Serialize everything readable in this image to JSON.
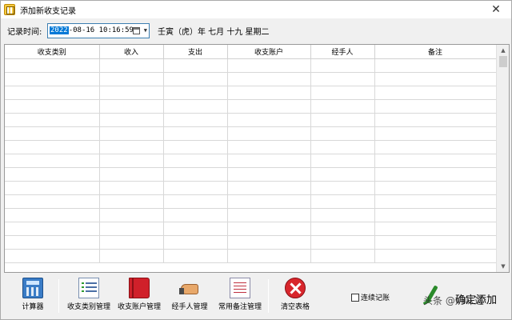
{
  "window": {
    "title": "添加新收支记录",
    "close_label": "✕"
  },
  "record_time": {
    "label": "记录时间:",
    "date_selected": "2022",
    "date_rest": "-08-16 10:16:59",
    "lunar": "壬寅（虎）年 七月 十九 星期二"
  },
  "grid": {
    "columns": [
      "收支类别",
      "收入",
      "支出",
      "收支账户",
      "经手人",
      "备注"
    ],
    "row_count": 15
  },
  "toolbar": {
    "calculator": "计算器",
    "category_mgmt": "收支类别管理",
    "account_mgmt": "收支账户管理",
    "handler_mgmt": "经手人管理",
    "note_mgmt": "常用备注管理",
    "clear_table": "清空表格",
    "continuous_label": "连续记账",
    "continuous_checked": false,
    "confirm_add": "确定添加"
  },
  "watermark": "头条 @奶味逗"
}
